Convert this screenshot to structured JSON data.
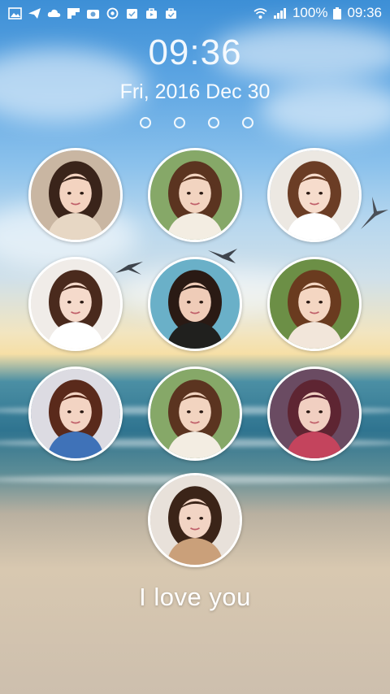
{
  "status_bar": {
    "left_icons": [
      "image-icon",
      "send-icon",
      "cloud-icon",
      "flipboard-icon",
      "gallery-icon",
      "sync-icon",
      "clipboard-icon",
      "bag-icon",
      "bag-check-icon"
    ],
    "battery": "100%",
    "time": "09:36"
  },
  "lockscreen": {
    "clock": "09:36",
    "date": "Fri, 2016 Dec 30",
    "page_dots": 4,
    "message": "I love you"
  },
  "photo_buttons": [
    {
      "name": "photo-1",
      "bg": "#c9b6a2",
      "hair": "#3a241a",
      "skin": "#f3d3c0",
      "accent": "#e7d7c4"
    },
    {
      "name": "photo-2",
      "bg": "#86a868",
      "hair": "#5b3420",
      "skin": "#f2d4c0",
      "accent": "#f3ede2"
    },
    {
      "name": "photo-3",
      "bg": "#ece8e2",
      "hair": "#6b3d25",
      "skin": "#f6dccc",
      "accent": "#ffffff"
    },
    {
      "name": "photo-4",
      "bg": "#f0ece8",
      "hair": "#4a2a1d",
      "skin": "#f5dacb",
      "accent": "#ffffff"
    },
    {
      "name": "photo-5",
      "bg": "#6ab0c8",
      "hair": "#2a1a14",
      "skin": "#efccb8",
      "accent": "#20201e"
    },
    {
      "name": "photo-6",
      "bg": "#6c8f46",
      "hair": "#6a3b1f",
      "skin": "#f4d6c2",
      "accent": "#f2e6da"
    },
    {
      "name": "photo-7",
      "bg": "#dcdbe2",
      "hair": "#5a2a1b",
      "skin": "#f3d4c3",
      "accent": "#3f72b8"
    },
    {
      "name": "photo-8",
      "bg": "#86a868",
      "hair": "#5b3420",
      "skin": "#f2d4c0",
      "accent": "#f3ede2"
    },
    {
      "name": "photo-9",
      "bg": "#6a4b62",
      "hair": "#5e2532",
      "skin": "#f1cfc1",
      "accent": "#c4445d"
    },
    {
      "name": "photo-10",
      "bg": "#e8e1da",
      "hair": "#3b2418",
      "skin": "#f2d4c4",
      "accent": "#caa07a"
    }
  ]
}
